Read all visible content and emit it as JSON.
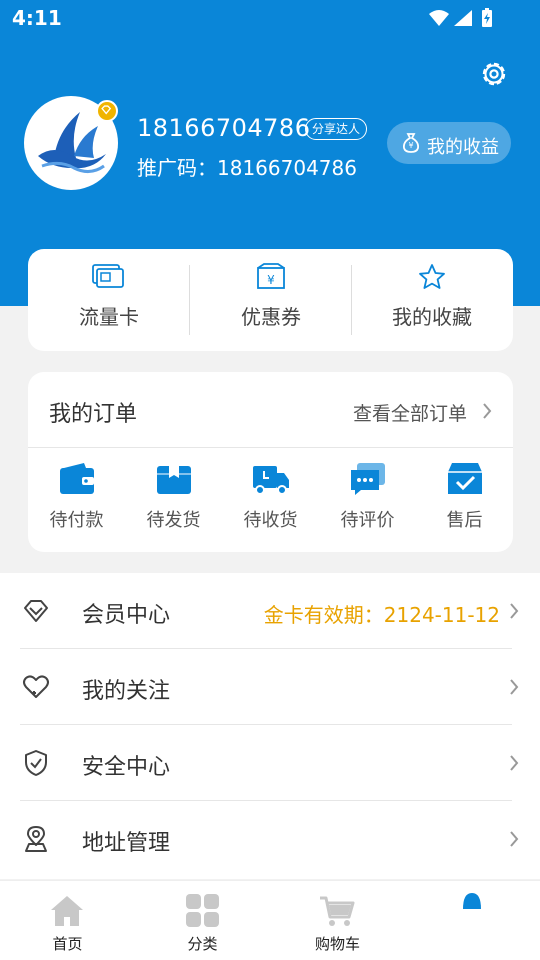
{
  "status_bar": {
    "time": "4:11"
  },
  "profile": {
    "phone": "18166704786",
    "badge": "分享达人",
    "promo_code": "推广码：18166704786",
    "earnings_label": "我的收益"
  },
  "quick_links": [
    {
      "label": "流量卡",
      "icon": "sim-card-icon"
    },
    {
      "label": "优惠券",
      "icon": "coupon-icon"
    },
    {
      "label": "我的收藏",
      "icon": "star-icon"
    }
  ],
  "orders": {
    "title": "我的订单",
    "view_all": "查看全部订单",
    "items": [
      {
        "label": "待付款",
        "icon": "wallet-icon"
      },
      {
        "label": "待发货",
        "icon": "box-icon"
      },
      {
        "label": "待收货",
        "icon": "truck-icon"
      },
      {
        "label": "待评价",
        "icon": "chat-icon"
      },
      {
        "label": "售后",
        "icon": "aftersale-icon"
      }
    ]
  },
  "menu": [
    {
      "label": "会员中心",
      "value": "金卡有效期：2124-11-12",
      "icon": "diamond-icon"
    },
    {
      "label": "我的关注",
      "value": "",
      "icon": "heart-icon"
    },
    {
      "label": "安全中心",
      "value": "",
      "icon": "shield-icon"
    },
    {
      "label": "地址管理",
      "value": "",
      "icon": "location-icon"
    }
  ],
  "tabs": [
    {
      "label": "首页",
      "icon": "home-icon"
    },
    {
      "label": "分类",
      "icon": "grid-icon"
    },
    {
      "label": "购物车",
      "icon": "cart-icon"
    },
    {
      "label": "",
      "icon": "profile-icon"
    }
  ],
  "colors": {
    "primary": "#0a86d8",
    "accent": "#e8a200",
    "tab_inactive": "#c8c8c8"
  }
}
